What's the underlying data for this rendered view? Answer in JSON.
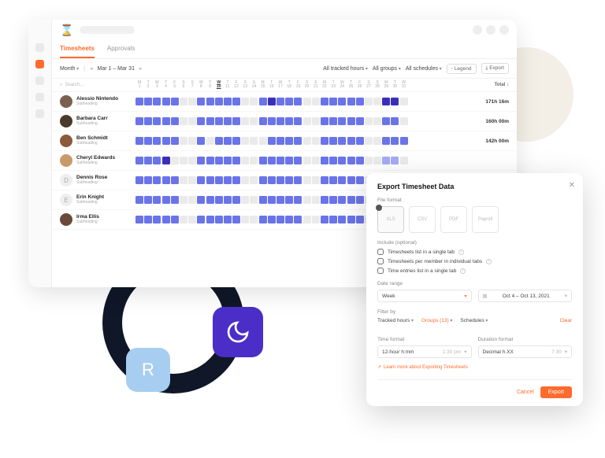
{
  "logo_text": "⌛",
  "tabs": {
    "timesheets": "Timesheets",
    "approvals": "Approvals"
  },
  "filters": {
    "period": "Month",
    "range": "Mar 1 – Mar 31",
    "tracked": "All tracked hours",
    "groups": "All groups",
    "schedules": "All schedules",
    "legend": "Legend",
    "export": "Export"
  },
  "search_placeholder": "Search...",
  "day_letters": [
    "M",
    "T",
    "W",
    "T",
    "F",
    "S",
    "S",
    "M",
    "T",
    "W",
    "T",
    "F",
    "S",
    "S",
    "M",
    "T",
    "W",
    "T",
    "F",
    "S",
    "S",
    "M",
    "T",
    "W",
    "T",
    "F",
    "S",
    "S",
    "M",
    "T",
    "W"
  ],
  "day_numbers": [
    "1",
    "2",
    "3",
    "4",
    "5",
    "6",
    "7",
    "8",
    "9",
    "10",
    "11",
    "12",
    "13",
    "14",
    "15",
    "16",
    "17",
    "18",
    "19",
    "20",
    "21",
    "22",
    "23",
    "24",
    "25",
    "26",
    "27",
    "28",
    "29",
    "30",
    "31"
  ],
  "current_day_index": 9,
  "total_header": "Total",
  "sort_icon": "↕",
  "members": [
    {
      "name": "Alessio Nintendo",
      "sub": "Subheading",
      "total": "171h 16m",
      "avatar": "a",
      "cells": [
        "n",
        "n",
        "n",
        "n",
        "n",
        "e",
        "e",
        "n",
        "n",
        "n",
        "n",
        "n",
        "e",
        "e",
        "n",
        "d",
        "n",
        "n",
        "n",
        "e",
        "e",
        "n",
        "n",
        "n",
        "n",
        "n",
        "e",
        "e",
        "d",
        "d",
        "e"
      ]
    },
    {
      "name": "Barbara Carr",
      "sub": "Subheading",
      "total": "160h 00m",
      "avatar": "b",
      "cells": [
        "n",
        "n",
        "n",
        "n",
        "n",
        "e",
        "e",
        "n",
        "n",
        "n",
        "n",
        "n",
        "e",
        "e",
        "n",
        "n",
        "n",
        "n",
        "n",
        "e",
        "e",
        "n",
        "n",
        "n",
        "n",
        "n",
        "e",
        "e",
        "n",
        "n",
        "e"
      ]
    },
    {
      "name": "Ben Schmidt",
      "sub": "Subheading",
      "total": "142h 00m",
      "avatar": "c",
      "cells": [
        "n",
        "n",
        "n",
        "n",
        "n",
        "e",
        "e",
        "n",
        "e",
        "n",
        "n",
        "n",
        "e",
        "e",
        "e",
        "n",
        "n",
        "n",
        "n",
        "e",
        "e",
        "n",
        "n",
        "n",
        "n",
        "n",
        "e",
        "e",
        "n",
        "n",
        "n"
      ]
    },
    {
      "name": "Cheryl Edwards",
      "sub": "Subheading",
      "total": "",
      "avatar": "d",
      "cells": [
        "n",
        "n",
        "n",
        "d",
        "e",
        "e",
        "e",
        "n",
        "n",
        "n",
        "n",
        "n",
        "e",
        "e",
        "n",
        "n",
        "n",
        "n",
        "n",
        "e",
        "e",
        "n",
        "n",
        "n",
        "n",
        "n",
        "e",
        "e",
        "l",
        "l",
        "e"
      ]
    },
    {
      "name": "Dennis Rose",
      "sub": "Subheading",
      "total": "",
      "avatar": "e",
      "initial": "D",
      "cells": [
        "n",
        "n",
        "n",
        "n",
        "n",
        "e",
        "e",
        "n",
        "n",
        "n",
        "n",
        "n",
        "e",
        "e",
        "n",
        "n",
        "n",
        "n",
        "n",
        "e",
        "e",
        "n",
        "n",
        "n",
        "n",
        "n",
        "e",
        "e",
        "n",
        "n",
        "n"
      ]
    },
    {
      "name": "Erin Knight",
      "sub": "Subheading",
      "total": "",
      "avatar": "e",
      "initial": "E",
      "cells": [
        "n",
        "n",
        "n",
        "n",
        "n",
        "e",
        "e",
        "n",
        "n",
        "n",
        "n",
        "n",
        "e",
        "e",
        "n",
        "n",
        "n",
        "n",
        "n",
        "e",
        "e",
        "n",
        "n",
        "n",
        "n",
        "n",
        "e",
        "e",
        "n",
        "n",
        "n"
      ]
    },
    {
      "name": "Irma Ellis",
      "sub": "Subheading",
      "total": "",
      "avatar": "f",
      "cells": [
        "n",
        "n",
        "n",
        "n",
        "n",
        "e",
        "e",
        "n",
        "n",
        "n",
        "n",
        "n",
        "e",
        "e",
        "n",
        "n",
        "n",
        "n",
        "n",
        "e",
        "e",
        "n",
        "n",
        "n",
        "n",
        "n",
        "e",
        "e",
        "n",
        "n",
        "n"
      ]
    }
  ],
  "modal": {
    "title": "Export Timesheet Data",
    "file_format_label": "File format",
    "formats": [
      "XLS",
      "CSV",
      "PDF",
      "Payroll"
    ],
    "include_label": "Include (optional)",
    "include_opts": [
      "Timesheets list in a single tab",
      "Timesheets per member in individual tabs",
      "Time entries list in a single tab"
    ],
    "date_range_label": "Date range",
    "date_range_period": "Week",
    "date_range_value": "Oct 4 – Oct 13, 2021",
    "filter_by_label": "Filter by",
    "filter_tracked": "Tracked hours",
    "filter_groups": "Groups (13)",
    "filter_schedules": "Schedules",
    "clear": "Clear",
    "time_format_label": "Time format",
    "time_format_value": "12-hour h:mm",
    "time_format_sample": "1:30 pm",
    "duration_format_label": "Duration format",
    "duration_format_value": "Decimal h.XX",
    "duration_format_sample": "7.30",
    "learn_more": "Learn more about Exporting Timesheets",
    "cancel": "Cancel",
    "export": "Export"
  },
  "deco": {
    "r_tile": "R"
  }
}
